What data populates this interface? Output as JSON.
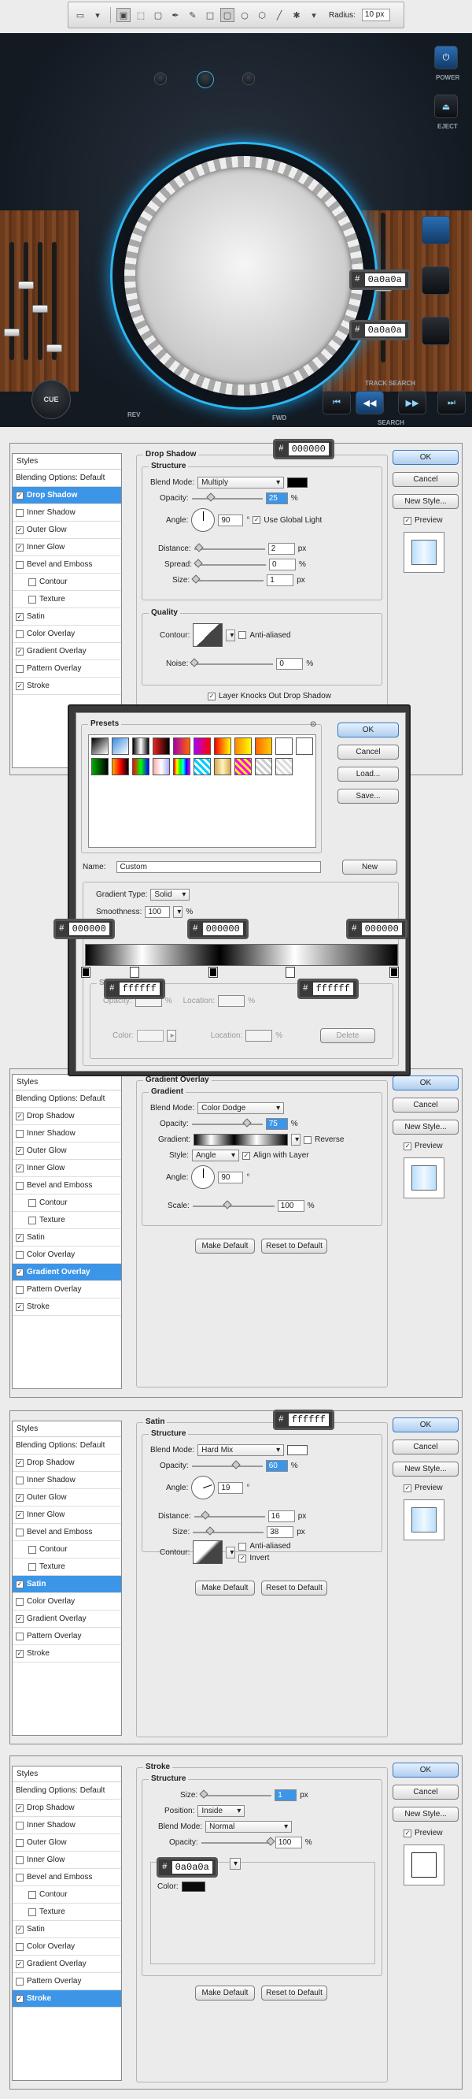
{
  "toolbar": {
    "radius_label": "Radius:",
    "radius_value": "10 px"
  },
  "dj": {
    "power": "POWER",
    "eject": "EJECT",
    "cue": "CUE",
    "rev": "REV",
    "fwd": "FWD",
    "track_search": "TRACK SEARCH",
    "search": "SEARCH",
    "tip1": "0a0a0a",
    "tip2": "0a0a0a"
  },
  "dialog": {
    "styles": "Styles",
    "blending": "Blending Options: Default",
    "items": [
      "Drop Shadow",
      "Inner Shadow",
      "Outer Glow",
      "Inner Glow",
      "Bevel and Emboss",
      "Contour",
      "Texture",
      "Satin",
      "Color Overlay",
      "Gradient Overlay",
      "Pattern Overlay",
      "Stroke"
    ],
    "ok": "OK",
    "cancel": "Cancel",
    "new_style": "New Style...",
    "preview": "Preview",
    "make_default": "Make Default",
    "reset_default": "Reset to Default",
    "percent": "%",
    "px": "px",
    "degree": "°"
  },
  "drop_shadow": {
    "title": "Drop Shadow",
    "structure": "Structure",
    "blend_mode_label": "Blend Mode:",
    "blend_mode": "Multiply",
    "opacity_label": "Opacity:",
    "opacity": "25",
    "angle_label": "Angle:",
    "angle": "90",
    "global_light": "Use Global Light",
    "distance_label": "Distance:",
    "distance": "2",
    "spread_label": "Spread:",
    "spread": "0",
    "size_label": "Size:",
    "size": "1",
    "quality": "Quality",
    "contour_label": "Contour:",
    "anti_aliased": "Anti-aliased",
    "noise_label": "Noise:",
    "noise": "0",
    "knockout": "Layer Knocks Out Drop Shadow",
    "tip": "000000"
  },
  "gradient_editor": {
    "presets": "Presets",
    "ok": "OK",
    "cancel": "Cancel",
    "load": "Load...",
    "save": "Save...",
    "name_label": "Name:",
    "name": "Custom",
    "new": "New",
    "type_label": "Gradient Type:",
    "type": "Solid",
    "smooth_label": "Smoothness:",
    "smooth": "100",
    "stops_label": "Stops",
    "opacity_label": "Opacity:",
    "location_label": "Location:",
    "color_label": "Color:",
    "delete": "Delete",
    "tip_a": "000000",
    "tip_b": "000000",
    "tip_c": "000000",
    "tip_d": "ffffff",
    "tip_e": "ffffff"
  },
  "gradient_overlay": {
    "title": "Gradient Overlay",
    "gradient": "Gradient",
    "blend_mode_label": "Blend Mode:",
    "blend_mode": "Color Dodge",
    "opacity_label": "Opacity:",
    "opacity": "75",
    "gradient_label": "Gradient:",
    "reverse": "Reverse",
    "style_label": "Style:",
    "style": "Angle",
    "align": "Align with Layer",
    "angle_label": "Angle:",
    "angle": "90",
    "scale_label": "Scale:",
    "scale": "100"
  },
  "satin": {
    "title": "Satin",
    "structure": "Structure",
    "blend_mode_label": "Blend Mode:",
    "blend_mode": "Hard Mix",
    "opacity_label": "Opacity:",
    "opacity": "60",
    "angle_label": "Angle:",
    "angle": "19",
    "distance_label": "Distance:",
    "distance": "16",
    "size_label": "Size:",
    "size": "38",
    "contour_label": "Contour:",
    "anti_aliased": "Anti-aliased",
    "invert": "Invert",
    "tip": "ffffff"
  },
  "stroke": {
    "title": "Stroke",
    "structure": "Structure",
    "size_label": "Size:",
    "size": "1",
    "position_label": "Position:",
    "position": "Inside",
    "blend_mode_label": "Blend Mode:",
    "blend_mode": "Normal",
    "opacity_label": "Opacity:",
    "opacity": "100",
    "color_label": "Color:",
    "tip": "0a0a0a"
  },
  "colors": {
    "accent": "#3d95e8",
    "platter_glow": "#2fb6f0"
  }
}
